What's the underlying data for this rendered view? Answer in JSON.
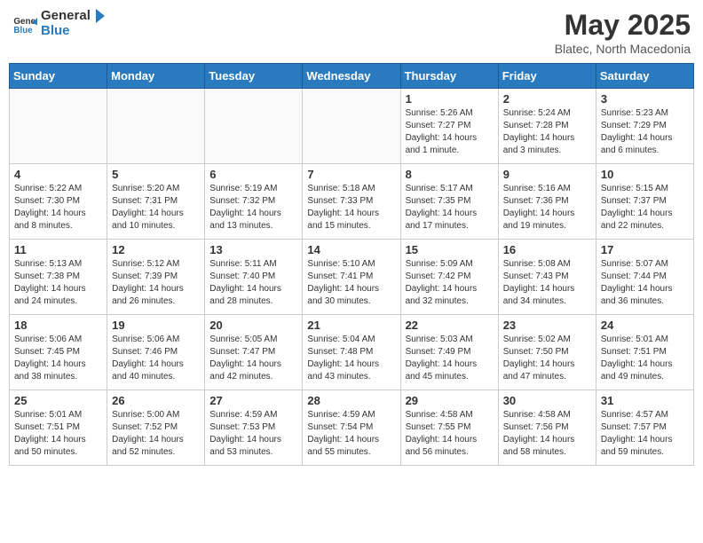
{
  "header": {
    "logo_general": "General",
    "logo_blue": "Blue",
    "title": "May 2025",
    "subtitle": "Blatec, North Macedonia"
  },
  "days_of_week": [
    "Sunday",
    "Monday",
    "Tuesday",
    "Wednesday",
    "Thursday",
    "Friday",
    "Saturday"
  ],
  "weeks": [
    [
      {
        "day": "",
        "info": ""
      },
      {
        "day": "",
        "info": ""
      },
      {
        "day": "",
        "info": ""
      },
      {
        "day": "",
        "info": ""
      },
      {
        "day": "1",
        "info": "Sunrise: 5:26 AM\nSunset: 7:27 PM\nDaylight: 14 hours\nand 1 minute."
      },
      {
        "day": "2",
        "info": "Sunrise: 5:24 AM\nSunset: 7:28 PM\nDaylight: 14 hours\nand 3 minutes."
      },
      {
        "day": "3",
        "info": "Sunrise: 5:23 AM\nSunset: 7:29 PM\nDaylight: 14 hours\nand 6 minutes."
      }
    ],
    [
      {
        "day": "4",
        "info": "Sunrise: 5:22 AM\nSunset: 7:30 PM\nDaylight: 14 hours\nand 8 minutes."
      },
      {
        "day": "5",
        "info": "Sunrise: 5:20 AM\nSunset: 7:31 PM\nDaylight: 14 hours\nand 10 minutes."
      },
      {
        "day": "6",
        "info": "Sunrise: 5:19 AM\nSunset: 7:32 PM\nDaylight: 14 hours\nand 13 minutes."
      },
      {
        "day": "7",
        "info": "Sunrise: 5:18 AM\nSunset: 7:33 PM\nDaylight: 14 hours\nand 15 minutes."
      },
      {
        "day": "8",
        "info": "Sunrise: 5:17 AM\nSunset: 7:35 PM\nDaylight: 14 hours\nand 17 minutes."
      },
      {
        "day": "9",
        "info": "Sunrise: 5:16 AM\nSunset: 7:36 PM\nDaylight: 14 hours\nand 19 minutes."
      },
      {
        "day": "10",
        "info": "Sunrise: 5:15 AM\nSunset: 7:37 PM\nDaylight: 14 hours\nand 22 minutes."
      }
    ],
    [
      {
        "day": "11",
        "info": "Sunrise: 5:13 AM\nSunset: 7:38 PM\nDaylight: 14 hours\nand 24 minutes."
      },
      {
        "day": "12",
        "info": "Sunrise: 5:12 AM\nSunset: 7:39 PM\nDaylight: 14 hours\nand 26 minutes."
      },
      {
        "day": "13",
        "info": "Sunrise: 5:11 AM\nSunset: 7:40 PM\nDaylight: 14 hours\nand 28 minutes."
      },
      {
        "day": "14",
        "info": "Sunrise: 5:10 AM\nSunset: 7:41 PM\nDaylight: 14 hours\nand 30 minutes."
      },
      {
        "day": "15",
        "info": "Sunrise: 5:09 AM\nSunset: 7:42 PM\nDaylight: 14 hours\nand 32 minutes."
      },
      {
        "day": "16",
        "info": "Sunrise: 5:08 AM\nSunset: 7:43 PM\nDaylight: 14 hours\nand 34 minutes."
      },
      {
        "day": "17",
        "info": "Sunrise: 5:07 AM\nSunset: 7:44 PM\nDaylight: 14 hours\nand 36 minutes."
      }
    ],
    [
      {
        "day": "18",
        "info": "Sunrise: 5:06 AM\nSunset: 7:45 PM\nDaylight: 14 hours\nand 38 minutes."
      },
      {
        "day": "19",
        "info": "Sunrise: 5:06 AM\nSunset: 7:46 PM\nDaylight: 14 hours\nand 40 minutes."
      },
      {
        "day": "20",
        "info": "Sunrise: 5:05 AM\nSunset: 7:47 PM\nDaylight: 14 hours\nand 42 minutes."
      },
      {
        "day": "21",
        "info": "Sunrise: 5:04 AM\nSunset: 7:48 PM\nDaylight: 14 hours\nand 43 minutes."
      },
      {
        "day": "22",
        "info": "Sunrise: 5:03 AM\nSunset: 7:49 PM\nDaylight: 14 hours\nand 45 minutes."
      },
      {
        "day": "23",
        "info": "Sunrise: 5:02 AM\nSunset: 7:50 PM\nDaylight: 14 hours\nand 47 minutes."
      },
      {
        "day": "24",
        "info": "Sunrise: 5:01 AM\nSunset: 7:51 PM\nDaylight: 14 hours\nand 49 minutes."
      }
    ],
    [
      {
        "day": "25",
        "info": "Sunrise: 5:01 AM\nSunset: 7:51 PM\nDaylight: 14 hours\nand 50 minutes."
      },
      {
        "day": "26",
        "info": "Sunrise: 5:00 AM\nSunset: 7:52 PM\nDaylight: 14 hours\nand 52 minutes."
      },
      {
        "day": "27",
        "info": "Sunrise: 4:59 AM\nSunset: 7:53 PM\nDaylight: 14 hours\nand 53 minutes."
      },
      {
        "day": "28",
        "info": "Sunrise: 4:59 AM\nSunset: 7:54 PM\nDaylight: 14 hours\nand 55 minutes."
      },
      {
        "day": "29",
        "info": "Sunrise: 4:58 AM\nSunset: 7:55 PM\nDaylight: 14 hours\nand 56 minutes."
      },
      {
        "day": "30",
        "info": "Sunrise: 4:58 AM\nSunset: 7:56 PM\nDaylight: 14 hours\nand 58 minutes."
      },
      {
        "day": "31",
        "info": "Sunrise: 4:57 AM\nSunset: 7:57 PM\nDaylight: 14 hours\nand 59 minutes."
      }
    ]
  ]
}
